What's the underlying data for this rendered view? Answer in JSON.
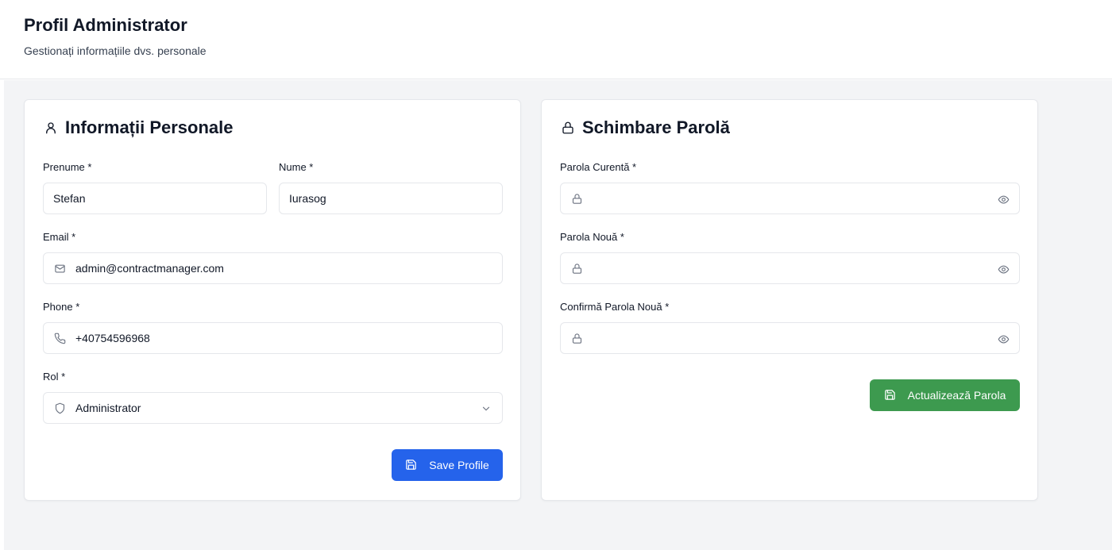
{
  "header": {
    "title": "Profil Administrator",
    "subtitle": "Gestionați informațiile dvs. personale"
  },
  "personal": {
    "title": "Informații Personale",
    "title_icon": "user-icon",
    "first_name_label": "Prenume *",
    "first_name_value": "Stefan",
    "last_name_label": "Nume *",
    "last_name_value": "Iurasog",
    "email_label": "Email *",
    "email_value": "admin@contractmanager.com",
    "email_icon": "mail-icon",
    "phone_label": "Phone *",
    "phone_value": "+40754596968",
    "phone_icon": "phone-icon",
    "role_label": "Rol *",
    "role_value": "Administrator",
    "role_icon": "shield-icon",
    "save_label": "Save Profile",
    "save_color": "#2563eb"
  },
  "password": {
    "title": "Schimbare Parolă",
    "title_icon": "lock-icon",
    "current_label": "Parola Curentă *",
    "new_label": "Parola Nouă *",
    "confirm_label": "Confirmă Parola Nouă *",
    "update_label": "Actualizează Parola",
    "update_color": "#3d9a4f"
  }
}
